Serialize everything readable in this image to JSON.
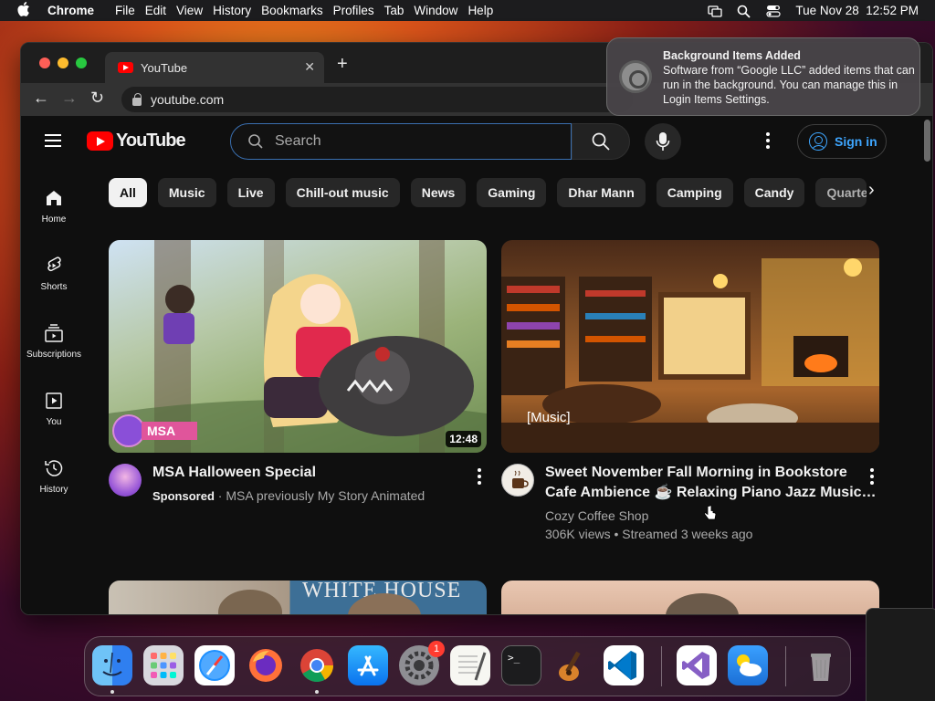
{
  "menubar": {
    "apple": "",
    "app_name": "Chrome",
    "items": [
      "File",
      "Edit",
      "View",
      "History",
      "Bookmarks",
      "Profiles",
      "Tab",
      "Window",
      "Help"
    ],
    "datetime": "Tue Nov 28  12:52 PM"
  },
  "browser": {
    "tab_title": "YouTube",
    "tab_close": "✕",
    "new_tab": "+",
    "back": "←",
    "forward": "→",
    "reload": "↻",
    "url": "youtube.com"
  },
  "youtube": {
    "logo_text": "YouTube",
    "search_placeholder": "Search",
    "signin_label": "Sign in",
    "guide": [
      {
        "label": "Home",
        "icon": "home-icon"
      },
      {
        "label": "Shorts",
        "icon": "shorts-icon"
      },
      {
        "label": "Subscriptions",
        "icon": "subscriptions-icon"
      },
      {
        "label": "You",
        "icon": "you-icon"
      },
      {
        "label": "History",
        "icon": "history-icon"
      }
    ],
    "chips": [
      "All",
      "Music",
      "Live",
      "Chill-out music",
      "News",
      "Gaming",
      "Dhar Mann",
      "Camping",
      "Candy",
      "Quarte"
    ],
    "chip_next": "›",
    "videos": [
      {
        "title": "MSA Halloween Special",
        "sponsored": "Sponsored",
        "channel": "MSA previously My Story Animated",
        "duration": "12:48",
        "badge_text": "MSA"
      },
      {
        "title_line1": "Sweet November Fall Morning in Bookstore",
        "title_line2": "Cafe Ambience ☕ Relaxing Piano Jazz Music…",
        "channel": "Cozy Coffee Shop",
        "stats": "306K views • Streamed 3 weeks ago",
        "overlay": "[Music]"
      }
    ],
    "partial_thumb_text": "WHITE HOUSE"
  },
  "notification": {
    "title": "Background Items Added",
    "body": "Software from “Google LLC” added items that can run in the background. You can manage this in Login Items Settings."
  },
  "dock": {
    "apps": [
      "Finder",
      "Launchpad",
      "Safari",
      "Firefox",
      "Google Chrome",
      "App Store",
      "System Settings",
      "TextEdit",
      "Terminal",
      "GarageBand",
      "Visual Studio Code",
      "Visual Studio",
      "Weather",
      "Trash"
    ],
    "settings_badge": "1",
    "terminal_prompt": ">_"
  },
  "colors": {
    "yt_red": "#ff0000",
    "link_blue": "#3ea6ff",
    "bg": "#0f0f0f",
    "chip": "#272727"
  }
}
